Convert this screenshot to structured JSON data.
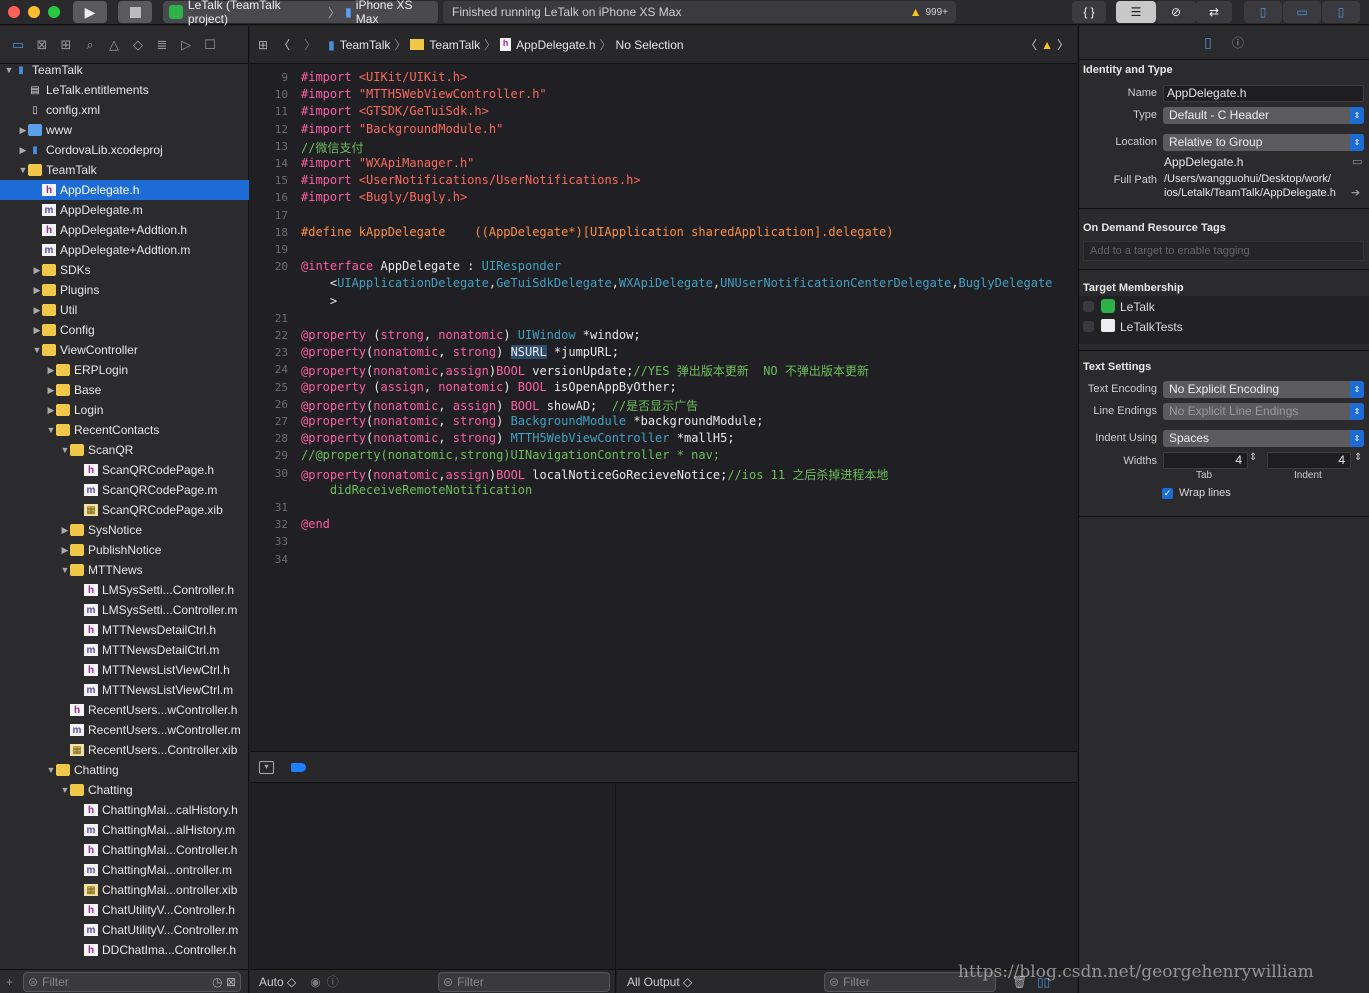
{
  "toolbar": {
    "scheme": "LeTalk (TeamTalk project)",
    "device": "iPhone XS Max",
    "status": "Finished running LeTalk on iPhone XS Max",
    "warning_count": "999+",
    "braces": "{ }"
  },
  "navigator": {
    "rows": [
      {
        "label": "TeamTalk",
        "indent": 0,
        "tri": "▼",
        "icon": "project"
      },
      {
        "label": "LeTalk.entitlements",
        "indent": 1,
        "tri": "",
        "icon": "plist"
      },
      {
        "label": "config.xml",
        "indent": 1,
        "tri": "",
        "icon": "file"
      },
      {
        "label": "www",
        "indent": 1,
        "tri": "▶",
        "icon": "bluefolder"
      },
      {
        "label": "CordovaLib.xcodeproj",
        "indent": 1,
        "tri": "▶",
        "icon": "project"
      },
      {
        "label": "TeamTalk",
        "indent": 1,
        "tri": "▼",
        "icon": "folder"
      },
      {
        "label": "AppDelegate.h",
        "indent": 2,
        "tri": "",
        "icon": "h",
        "selected": true
      },
      {
        "label": "AppDelegate.m",
        "indent": 2,
        "tri": "",
        "icon": "m"
      },
      {
        "label": "AppDelegate+Addtion.h",
        "indent": 2,
        "tri": "",
        "icon": "h"
      },
      {
        "label": "AppDelegate+Addtion.m",
        "indent": 2,
        "tri": "",
        "icon": "m"
      },
      {
        "label": "SDKs",
        "indent": 2,
        "tri": "▶",
        "icon": "folder"
      },
      {
        "label": "Plugins",
        "indent": 2,
        "tri": "▶",
        "icon": "folder"
      },
      {
        "label": "Util",
        "indent": 2,
        "tri": "▶",
        "icon": "folder"
      },
      {
        "label": "Config",
        "indent": 2,
        "tri": "▶",
        "icon": "folder"
      },
      {
        "label": "ViewController",
        "indent": 2,
        "tri": "▼",
        "icon": "folder"
      },
      {
        "label": "ERPLogin",
        "indent": 3,
        "tri": "▶",
        "icon": "folder"
      },
      {
        "label": "Base",
        "indent": 3,
        "tri": "▶",
        "icon": "folder"
      },
      {
        "label": "Login",
        "indent": 3,
        "tri": "▶",
        "icon": "folder"
      },
      {
        "label": "RecentContacts",
        "indent": 3,
        "tri": "▼",
        "icon": "folder"
      },
      {
        "label": "ScanQR",
        "indent": 4,
        "tri": "▼",
        "icon": "folder"
      },
      {
        "label": "ScanQRCodePage.h",
        "indent": 5,
        "tri": "",
        "icon": "h"
      },
      {
        "label": "ScanQRCodePage.m",
        "indent": 5,
        "tri": "",
        "icon": "m"
      },
      {
        "label": "ScanQRCodePage.xib",
        "indent": 5,
        "tri": "",
        "icon": "xib"
      },
      {
        "label": "SysNotice",
        "indent": 4,
        "tri": "▶",
        "icon": "folder"
      },
      {
        "label": "PublishNotice",
        "indent": 4,
        "tri": "▶",
        "icon": "folder"
      },
      {
        "label": "MTTNews",
        "indent": 4,
        "tri": "▼",
        "icon": "folder"
      },
      {
        "label": "LMSysSetti...Controller.h",
        "indent": 5,
        "tri": "",
        "icon": "h"
      },
      {
        "label": "LMSysSetti...Controller.m",
        "indent": 5,
        "tri": "",
        "icon": "m"
      },
      {
        "label": "MTTNewsDetailCtrl.h",
        "indent": 5,
        "tri": "",
        "icon": "h"
      },
      {
        "label": "MTTNewsDetailCtrl.m",
        "indent": 5,
        "tri": "",
        "icon": "m"
      },
      {
        "label": "MTTNewsListViewCtrl.h",
        "indent": 5,
        "tri": "",
        "icon": "h"
      },
      {
        "label": "MTTNewsListViewCtrl.m",
        "indent": 5,
        "tri": "",
        "icon": "m"
      },
      {
        "label": "RecentUsers...wController.h",
        "indent": 4,
        "tri": "",
        "icon": "h"
      },
      {
        "label": "RecentUsers...wController.m",
        "indent": 4,
        "tri": "",
        "icon": "m"
      },
      {
        "label": "RecentUsers...Controller.xib",
        "indent": 4,
        "tri": "",
        "icon": "xib"
      },
      {
        "label": "Chatting",
        "indent": 3,
        "tri": "▼",
        "icon": "folder"
      },
      {
        "label": "Chatting",
        "indent": 4,
        "tri": "▼",
        "icon": "folder"
      },
      {
        "label": "ChattingMai...calHistory.h",
        "indent": 5,
        "tri": "",
        "icon": "h"
      },
      {
        "label": "ChattingMai...alHistory.m",
        "indent": 5,
        "tri": "",
        "icon": "m"
      },
      {
        "label": "ChattingMai...Controller.h",
        "indent": 5,
        "tri": "",
        "icon": "h"
      },
      {
        "label": "ChattingMai...ontroller.m",
        "indent": 5,
        "tri": "",
        "icon": "m"
      },
      {
        "label": "ChattingMai...ontroller.xib",
        "indent": 5,
        "tri": "",
        "icon": "xib"
      },
      {
        "label": "ChatUtilityV...Controller.h",
        "indent": 5,
        "tri": "",
        "icon": "h"
      },
      {
        "label": "ChatUtilityV...Controller.m",
        "indent": 5,
        "tri": "",
        "icon": "m"
      },
      {
        "label": "DDChatIma...Controller.h",
        "indent": 5,
        "tri": "",
        "icon": "h"
      }
    ],
    "filter_placeholder": "Filter"
  },
  "jumpbar": {
    "crumbs": [
      "TeamTalk",
      "TeamTalk",
      "AppDelegate.h",
      "No Selection"
    ]
  },
  "code": [
    {
      "n": "9",
      "y": 0,
      "html": "<span class='kw'>#import</span> <span class='str'>&lt;UIKit/UIKit.h&gt;</span>"
    },
    {
      "n": "10",
      "y": 1,
      "html": "<span class='kw'>#import</span> <span class='str'>\"MTTH5WebViewController.h\"</span>"
    },
    {
      "n": "11",
      "y": 2,
      "html": "<span class='kw'>#import</span> <span class='str'>&lt;GTSDK/GeTuiSdk.h&gt;</span>"
    },
    {
      "n": "12",
      "y": 3,
      "html": "<span class='kw'>#import</span> <span class='str'>\"BackgroundModule.h\"</span>"
    },
    {
      "n": "13",
      "y": 4,
      "html": "<span class='cm'>//微信支付</span>"
    },
    {
      "n": "14",
      "y": 5,
      "html": "<span class='kw'>#import</span> <span class='str'>\"WXApiManager.h\"</span>"
    },
    {
      "n": "15",
      "y": 6,
      "html": "<span class='kw'>#import</span> <span class='str'>&lt;UserNotifications/UserNotifications.h&gt;</span>"
    },
    {
      "n": "16",
      "y": 7,
      "html": "<span class='kw'>#import</span> <span class='str'>&lt;Bugly/Bugly.h&gt;</span>"
    },
    {
      "n": "17",
      "y": 8,
      "html": ""
    },
    {
      "n": "18",
      "y": 9,
      "html": "<span class='pp'>#define kAppDelegate    ((AppDelegate*)[UIApplication sharedApplication].delegate)</span>"
    },
    {
      "n": "19",
      "y": 10,
      "html": ""
    },
    {
      "n": "20",
      "y": 11,
      "html": "<span class='kw'>@interface</span> AppDelegate : <span class='cls'>UIResponder</span>"
    },
    {
      "n": "",
      "y": 12,
      "html": "    &lt;<span class='cls'>UIApplicationDelegate</span>,<span class='cls'>GeTuiSdkDelegate</span>,<span class='cls'>WXApiDelegate</span>,<span class='cls'>UNUserNotificationCenterDelegate</span>,<span class='cls'>BuglyDelegate</span>"
    },
    {
      "n": "",
      "y": 13,
      "html": "    &gt;"
    },
    {
      "n": "21",
      "y": 14,
      "html": ""
    },
    {
      "n": "22",
      "y": 15,
      "html": "<span class='kw'>@property</span> (<span class='kw'>strong</span>, <span class='kw'>nonatomic</span>) <span class='cls'>UIWindow</span> *window;"
    },
    {
      "n": "23",
      "y": 16,
      "html": "<span class='kw'>@property</span>(<span class='kw'>nonatomic</span>, <span class='kw'>strong</span>) <span style='background:#2f4b6e'>NSURL</span> *jumpURL;"
    },
    {
      "n": "24",
      "y": 17,
      "html": "<span class='kw'>@property</span>(<span class='kw'>nonatomic</span>,<span class='kw'>assign</span>)<span class='kw'>BOOL</span> versionUpdate;<span class='cm'>//YES 弹出版本更新  NO 不弹出版本更新</span>"
    },
    {
      "n": "25",
      "y": 18,
      "html": "<span class='kw'>@property</span> (<span class='kw'>assign</span>, <span class='kw'>nonatomic</span>) <span class='kw'>BOOL</span> isOpenAppByOther;"
    },
    {
      "n": "26",
      "y": 19,
      "html": "<span class='kw'>@property</span>(<span class='kw'>nonatomic</span>, <span class='kw'>assign</span>) <span class='kw'>BOOL</span> showAD;  <span class='cm'>//是否显示广告</span>"
    },
    {
      "n": "27",
      "y": 20,
      "html": "<span class='kw'>@property</span>(<span class='kw'>nonatomic</span>, <span class='kw'>strong</span>) <span class='cls'>BackgroundModule</span> *backgroundModule;"
    },
    {
      "n": "28",
      "y": 21,
      "html": "<span class='kw'>@property</span>(<span class='kw'>nonatomic</span>, <span class='kw'>strong</span>) <span class='cls'>MTTH5WebViewController</span> *mallH5;"
    },
    {
      "n": "29",
      "y": 22,
      "html": "<span class='cm'>//@property(nonatomic,strong)UINavigationController * nav;</span>"
    },
    {
      "n": "30",
      "y": 23,
      "html": "<span class='kw'>@property</span>(<span class='kw'>nonatomic</span>,<span class='kw'>assign</span>)<span class='kw'>BOOL</span> localNoticeGoRecieveNotice;<span class='cm'>//ios 11 之后杀掉进程本地</span>"
    },
    {
      "n": "",
      "y": 24,
      "html": "    <span class='cm'>didReceiveRemoteNotification</span>"
    },
    {
      "n": "31",
      "y": 25,
      "html": ""
    },
    {
      "n": "32",
      "y": 26,
      "html": "<span class='kw'>@end</span>"
    },
    {
      "n": "33",
      "y": 27,
      "html": ""
    },
    {
      "n": "34",
      "y": 28,
      "html": ""
    }
  ],
  "debug": {
    "auto_label": "Auto ◇",
    "filter_left": "Filter",
    "output_label": "All Output ◇",
    "filter_right": "Filter"
  },
  "inspector": {
    "identity_title": "Identity and Type",
    "name_label": "Name",
    "name_value": "AppDelegate.h",
    "type_label": "Type",
    "type_value": "Default - C Header",
    "location_label": "Location",
    "location_value": "Relative to Group",
    "location_file": "AppDelegate.h",
    "fullpath_label": "Full Path",
    "fullpath_1": "/Users/wangguohui/Desktop/work/",
    "fullpath_2": "ios/Letalk/TeamTalk/AppDelegate.h",
    "odr_title": "On Demand Resource Tags",
    "odr_placeholder": "Add to a target to enable tagging",
    "target_title": "Target Membership",
    "target_1": "LeTalk",
    "target_2": "LeTalkTests",
    "text_title": "Text Settings",
    "enc_label": "Text Encoding",
    "enc_value": "No Explicit Encoding",
    "le_label": "Line Endings",
    "le_value": "No Explicit Line Endings",
    "indent_label": "Indent Using",
    "indent_value": "Spaces",
    "widths_label": "Widths",
    "tab_value": "4",
    "indent_width_value": "4",
    "tab_caption": "Tab",
    "indent_caption": "Indent",
    "wrap_label": "Wrap lines"
  },
  "watermark": "https://blog.csdn.net/georgehenrywilliam"
}
